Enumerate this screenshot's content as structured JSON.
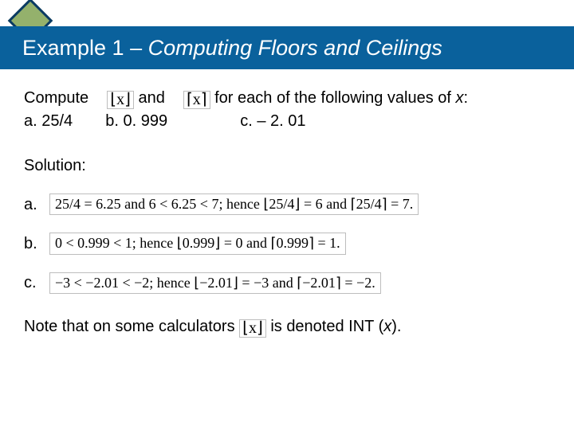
{
  "title": {
    "lead": "Example 1 – ",
    "rest": "Computing Floors and Ceilings"
  },
  "prompt": {
    "compute": "Compute",
    "floor_sym": "⌊x⌋",
    "and": "and",
    "ceil_sym": "⌈x⌉",
    "tail": "for each of the following values of ",
    "var": "x",
    "colon": ":"
  },
  "subs": {
    "a_label": "a. 25/4",
    "b_label": "b. 0. 999",
    "c_label": "c. – 2. 01"
  },
  "solution_label": "Solution:",
  "answers": {
    "a": {
      "label": "a.",
      "text": "25/4 = 6.25 and 6 < 6.25 < 7; hence ⌊25/4⌋ = 6 and ⌈25/4⌉ = 7."
    },
    "b": {
      "label": "b.",
      "text": "0 < 0.999 < 1; hence ⌊0.999⌋ = 0 and ⌈0.999⌉ = 1."
    },
    "c": {
      "label": "c.",
      "text": "−3 < −2.01 < −2; hence ⌊−2.01⌋ = −3 and ⌈−2.01⌉ = −2."
    }
  },
  "note": {
    "pre": "Note that on some calculators ",
    "sym": "⌊x⌋",
    "post": " is denoted INT (",
    "var": "x",
    "close": ")."
  }
}
